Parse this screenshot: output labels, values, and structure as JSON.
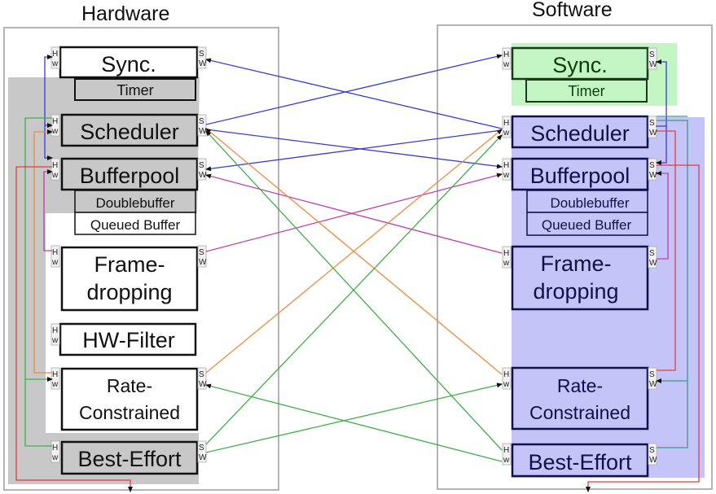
{
  "titles": {
    "hardware": "Hardware",
    "software": "Software"
  },
  "port_labels": {
    "hw_top": "H",
    "hw_bottom": "w",
    "sw_top": "S",
    "sw_bottom": "W"
  },
  "colors": {
    "hw_shade": "#c8c8c8",
    "sw_sync_shade": "#c4f5c4",
    "sw_shade": "#c4c4f8",
    "frame": "#b4b4b4",
    "blue": "#3b3bd0",
    "orange": "#f08a3c",
    "green": "#3fae4a",
    "magenta": "#c03ca8",
    "red": "#e03c3c",
    "teal": "#3a9a80"
  },
  "hardware": {
    "blocks": [
      {
        "id": "hw-sync",
        "label": "Sync.",
        "shaded": false
      },
      {
        "id": "hw-timer",
        "label": "Timer",
        "shaded": true
      },
      {
        "id": "hw-scheduler",
        "label": "Scheduler",
        "shaded": true
      },
      {
        "id": "hw-bufferpool",
        "label": "Bufferpool",
        "shaded": true
      },
      {
        "id": "hw-doublebuffer",
        "label": "Doublebuffer",
        "shaded": true
      },
      {
        "id": "hw-queued",
        "label": "Queued Buffer",
        "shaded": false
      },
      {
        "id": "hw-framedrop-1",
        "label": "Frame-",
        "shaded": false
      },
      {
        "id": "hw-framedrop-2",
        "label": "dropping",
        "shaded": false
      },
      {
        "id": "hw-filter",
        "label": "HW-Filter",
        "shaded": false
      },
      {
        "id": "hw-rate-1",
        "label": "Rate-",
        "shaded": false
      },
      {
        "id": "hw-rate-2",
        "label": "Constrained",
        "shaded": false
      },
      {
        "id": "hw-best",
        "label": "Best-Effort",
        "shaded": true
      }
    ]
  },
  "software": {
    "blocks": [
      {
        "id": "sw-sync",
        "label": "Sync."
      },
      {
        "id": "sw-timer",
        "label": "Timer"
      },
      {
        "id": "sw-scheduler",
        "label": "Scheduler"
      },
      {
        "id": "sw-bufferpool",
        "label": "Bufferpool"
      },
      {
        "id": "sw-doublebuffer",
        "label": "Doublebuffer"
      },
      {
        "id": "sw-queued",
        "label": "Queued Buffer"
      },
      {
        "id": "sw-framedrop-1",
        "label": "Frame-"
      },
      {
        "id": "sw-framedrop-2",
        "label": "dropping"
      },
      {
        "id": "sw-rate-1",
        "label": "Rate-"
      },
      {
        "id": "sw-rate-2",
        "label": "Constrained"
      },
      {
        "id": "sw-best",
        "label": "Best-Effort"
      }
    ]
  },
  "connections": [
    {
      "from": "Software Scheduler",
      "to": "Hardware Sync.",
      "color": "blue"
    },
    {
      "from": "Hardware Scheduler",
      "to": "Software Sync.",
      "color": "blue"
    },
    {
      "from": "Hardware Scheduler",
      "to": "Software Bufferpool",
      "color": "blue"
    },
    {
      "from": "Software Scheduler",
      "to": "Hardware Bufferpool",
      "color": "blue"
    },
    {
      "from": "Software Frame-dropping",
      "to": "Hardware Bufferpool",
      "color": "magenta"
    },
    {
      "from": "Hardware Frame-dropping",
      "to": "Software Bufferpool",
      "color": "magenta"
    },
    {
      "from": "Software Rate-Constrained",
      "to": "Hardware Scheduler",
      "color": "orange"
    },
    {
      "from": "Hardware Rate-Constrained",
      "to": "Software Scheduler",
      "color": "orange"
    },
    {
      "from": "Software Best-Effort",
      "to": "Hardware Scheduler",
      "color": "green"
    },
    {
      "from": "Hardware Best-Effort",
      "to": "Software Scheduler",
      "color": "green"
    },
    {
      "from": "Software Best-Effort",
      "to": "Hardware Rate-Constrained",
      "color": "green"
    },
    {
      "from": "Hardware Best-Effort",
      "to": "Software Rate-Constrained",
      "color": "green"
    }
  ]
}
